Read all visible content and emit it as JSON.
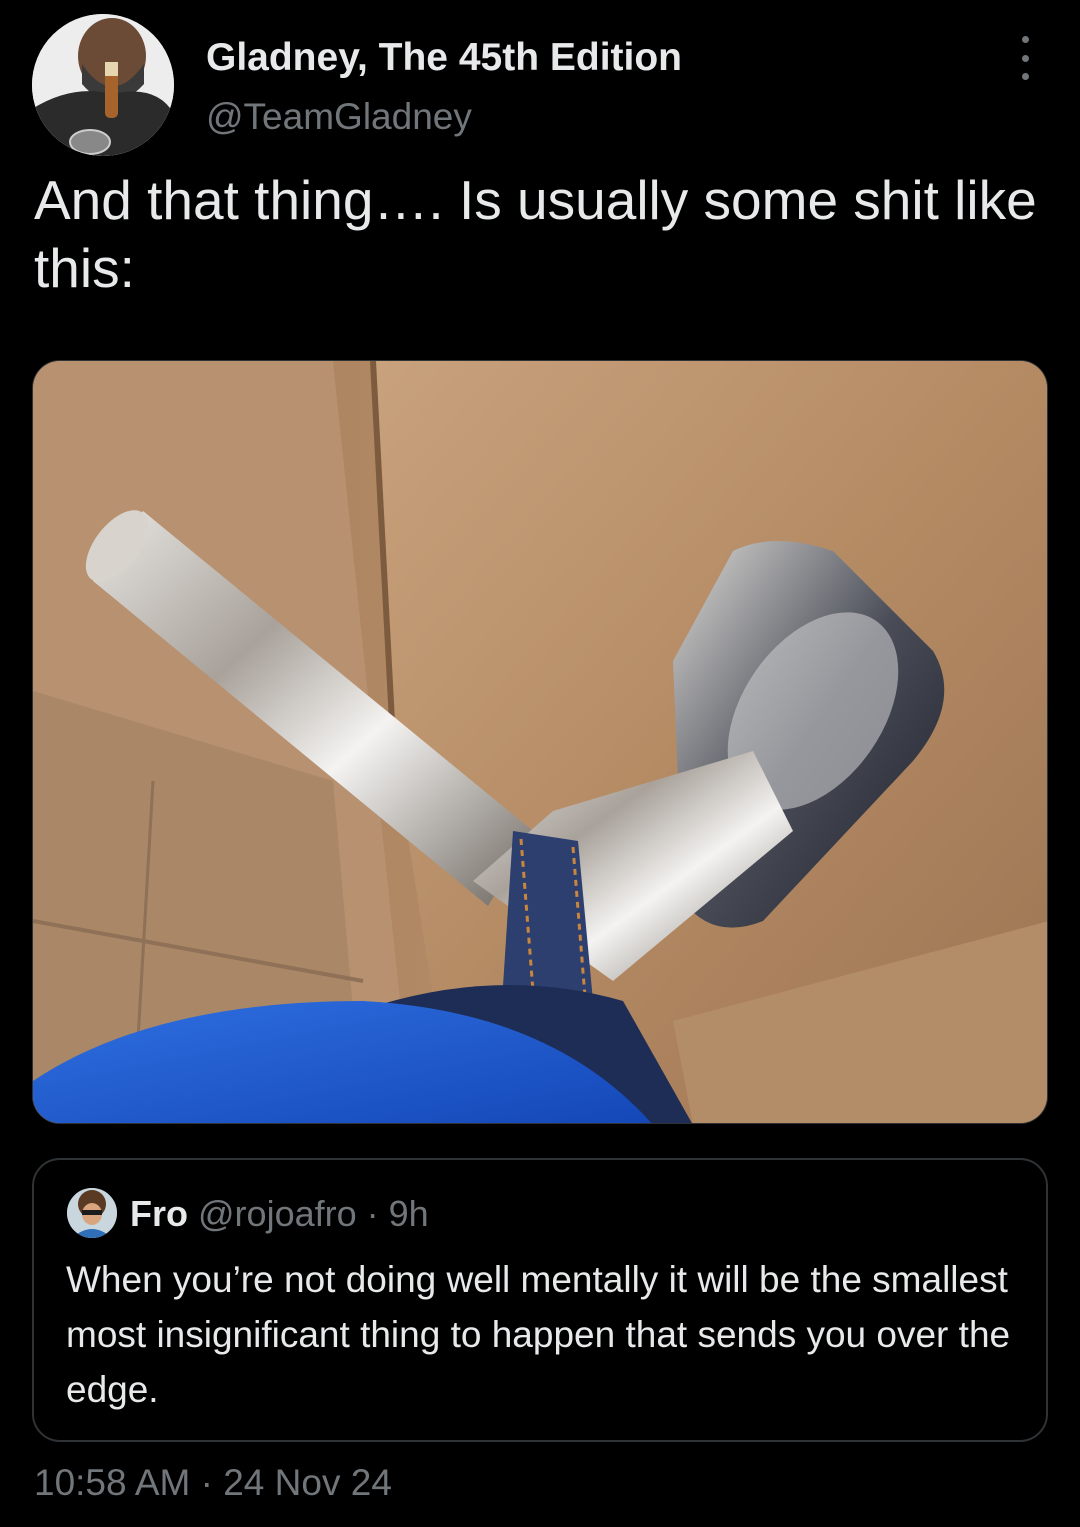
{
  "author": {
    "display_name": "Gladney, The 45th Edition",
    "handle": "@TeamGladney"
  },
  "tweet": {
    "text": "And that thing…. Is usually some shit like this:"
  },
  "quoted_tweet": {
    "display_name": "Fro",
    "handle": "@rojoafro",
    "separator": "·",
    "time_ago": "9h",
    "text": "When you’re not doing well mentally it will be the smallest most insignificant thing to happen that sends you over the edge."
  },
  "timestamp": {
    "time": "10:58 AM",
    "separator": "·",
    "date": "24 Nov 24"
  },
  "icons": {
    "more": "more-options-icon"
  },
  "colors": {
    "background": "#000000",
    "primary_text": "#e7e9ea",
    "secondary_text": "#71767b",
    "border": "#2f3336"
  }
}
